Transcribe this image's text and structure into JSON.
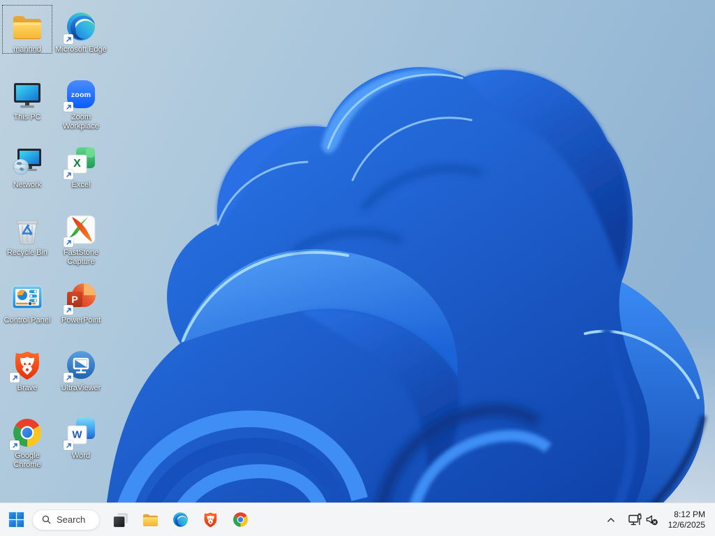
{
  "desktop": {
    "icons": [
      {
        "label": "manhnd",
        "icon": "folder-icon",
        "shortcut": false,
        "selected": true
      },
      {
        "label": "This PC",
        "icon": "this-pc-icon",
        "shortcut": false
      },
      {
        "label": "Network",
        "icon": "network-icon",
        "shortcut": false
      },
      {
        "label": "Recycle Bin",
        "icon": "recycle-bin-icon",
        "shortcut": false
      },
      {
        "label": "Control Panel",
        "icon": "control-panel-icon",
        "shortcut": false
      },
      {
        "label": "Brave",
        "icon": "brave-icon",
        "shortcut": true
      },
      {
        "label": "Google Chrome",
        "icon": "chrome-icon",
        "shortcut": true
      },
      {
        "label": "Microsoft Edge",
        "icon": "edge-icon",
        "shortcut": true
      },
      {
        "label": "Zoom Workplace",
        "icon": "zoom-icon",
        "shortcut": true,
        "letter": "zoom"
      },
      {
        "label": "Excel",
        "icon": "excel-icon",
        "shortcut": true,
        "letter": "X"
      },
      {
        "label": "FastStone Capture",
        "icon": "faststone-icon",
        "shortcut": true
      },
      {
        "label": "PowerPoint",
        "icon": "powerpoint-icon",
        "shortcut": true,
        "letter": "P"
      },
      {
        "label": "UltraViewer",
        "icon": "ultraviewer-icon",
        "shortcut": true
      },
      {
        "label": "Word",
        "icon": "word-icon",
        "shortcut": true,
        "letter": "W"
      }
    ]
  },
  "taskbar": {
    "search": {
      "label": "Search",
      "icon": "search-icon"
    },
    "buttons": [
      "start-button",
      "search",
      "task-view-button",
      "file-explorer-button",
      "edge-button",
      "brave-button",
      "chrome-button"
    ],
    "tray": {
      "icons": [
        "chevron-up-icon",
        "ethernet-icon",
        "volume-muted-icon"
      ],
      "time": "8:12 PM",
      "date": "12/6/2025"
    }
  },
  "colors": {
    "taskbar_bg": "#f3f5f7",
    "wallpaper_sky": "#a3c2da",
    "wallpaper_petal_bright": "#2e7cf0",
    "wallpaper_petal_dark": "#0d3fa6",
    "accent_blue": "#0b5cff"
  }
}
